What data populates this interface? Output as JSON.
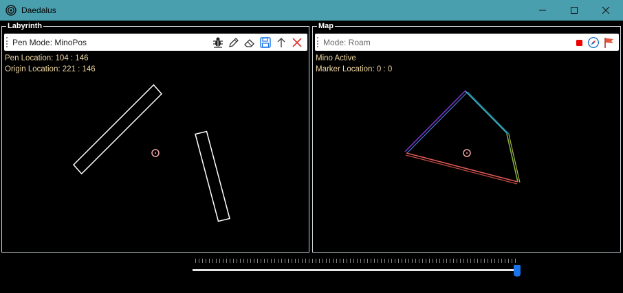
{
  "window": {
    "title": "Daedalus",
    "minimize_glyph": "—",
    "maximize_glyph": "☐",
    "close_glyph": "✕"
  },
  "labyrinth": {
    "label": "Labyrinth",
    "toolbar": {
      "mode_text": "Pen Mode: MinoPos",
      "icons": [
        "bug-icon",
        "pen-icon",
        "eraser-icon",
        "save-icon",
        "arrow-up-icon",
        "close-icon"
      ]
    },
    "pen_location": "Pen Location: 104 : 146",
    "origin_location": "Origin Location: 221 : 146"
  },
  "map": {
    "label": "Map",
    "toolbar": {
      "mode_text": "Mode: Roam",
      "icons": [
        "stop-icon",
        "compass-icon",
        "flag-icon"
      ]
    },
    "status": "Mino Active",
    "marker_location": "Marker Location: 0 : 0"
  },
  "slider": {
    "value_fraction": 0.99
  },
  "colors": {
    "titlebar": "#4a9fae",
    "info_text": "#f1d9a5",
    "slider_thumb": "#1a73e8"
  }
}
